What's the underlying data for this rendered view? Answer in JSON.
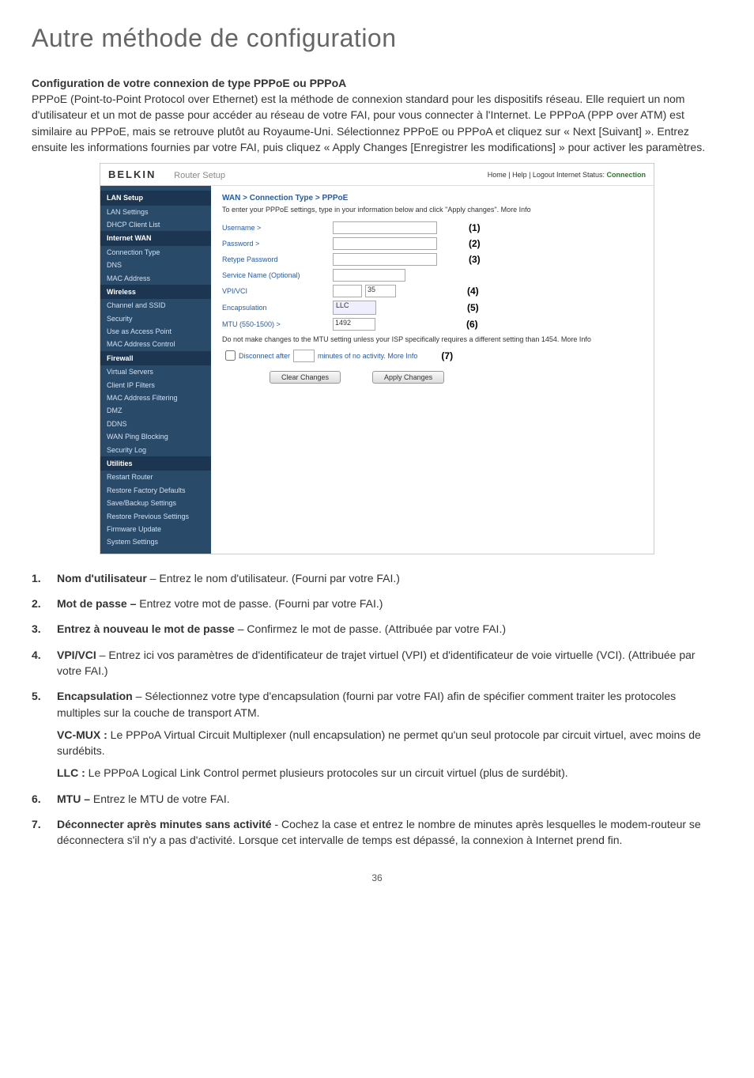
{
  "page": {
    "title": "Autre méthode de configuration",
    "number": "36"
  },
  "heading": "Configuration de votre connexion de type PPPoE ou PPPoA",
  "intro": "PPPoE (Point-to-Point Protocol over Ethernet) est la méthode de connexion standard pour les dispositifs réseau. Elle requiert un nom d'utilisateur et un mot de passe pour accéder au réseau de votre FAI, pour vous connecter à l'Internet. Le PPPoA (PPP over ATM) est similaire au PPPoE, mais se retrouve plutôt au Royaume-Uni. Sélectionnez PPPoE ou PPPoA et cliquez sur « Next [Suivant] ». Entrez ensuite les informations fournies par votre FAI, puis cliquez « Apply Changes [Enregistrer les modifications] » pour activer les paramètres.",
  "screenshot": {
    "brand": "BELKIN",
    "subtitle": "Router Setup",
    "status_prefix": "Home | Help | Logout   Internet Status:",
    "status_value": "Connection",
    "breadcrumb": "WAN > Connection Type > PPPoE",
    "hint": "To enter your PPPoE settings, type in your information below and click \"Apply changes\". More Info",
    "rows": {
      "username": "Username >",
      "password": "Password >",
      "retype": "Retype Password",
      "service": "Service Name (Optional)",
      "vpivci": "VPI/VCI",
      "vpivci_val2": "35",
      "encap": "Encapsulation",
      "encap_val": "LLC",
      "mtu": "MTU (550-1500) >",
      "mtu_val": "1492"
    },
    "markers": {
      "m1": "(1)",
      "m2": "(2)",
      "m3": "(3)",
      "m4": "(4)",
      "m5": "(5)",
      "m6": "(6)",
      "m7": "(7)"
    },
    "mtu_note": "Do not make changes to the MTU setting unless your ISP specifically requires a different setting than 1454. More Info",
    "disconnect_label": "Disconnect after",
    "disconnect_suffix": "minutes of no activity. More Info",
    "clear_btn": "Clear Changes",
    "apply_btn": "Apply Changes",
    "sidebar": {
      "h1": "LAN Setup",
      "i1": "LAN Settings",
      "i2": "DHCP Client List",
      "h2": "Internet WAN",
      "i3": "Connection Type",
      "i4": "DNS",
      "i5": "MAC Address",
      "h3": "Wireless",
      "i6": "Channel and SSID",
      "i7": "Security",
      "i8": "Use as Access Point",
      "i9": "MAC Address Control",
      "h4": "Firewall",
      "i10": "Virtual Servers",
      "i11": "Client IP Filters",
      "i12": "MAC Address Filtering",
      "i13": "DMZ",
      "i14": "DDNS",
      "i15": "WAN Ping Blocking",
      "i16": "Security Log",
      "h5": "Utilities",
      "i17": "Restart Router",
      "i18": "Restore Factory Defaults",
      "i19": "Save/Backup Settings",
      "i20": "Restore Previous Settings",
      "i21": "Firmware Update",
      "i22": "System Settings"
    }
  },
  "list": {
    "n1": "1.",
    "t1": "Nom d'utilisateur",
    "d1": " – Entrez le nom d'utilisateur. (Fourni par votre FAI.)",
    "n2": "2.",
    "t2": "Mot de passe –",
    "d2": " Entrez votre mot de passe. (Fourni par votre FAI.)",
    "n3": "3.",
    "t3": "Entrez à nouveau le mot de passe",
    "d3": " – Confirmez le mot de passe. (Attribuée par votre FAI.)",
    "n4": "4.",
    "t4": "VPI/VCI",
    "d4": " – Entrez ici vos paramètres de d'identificateur de trajet virtuel (VPI) et d'identificateur de voie virtuelle (VCI). (Attribuée par votre FAI.)",
    "n5": "5.",
    "t5": "Encapsulation",
    "d5": " – Sélectionnez votre type d'encapsulation (fourni par votre FAI) afin de spécifier comment traiter les protocoles multiples sur la couche de transport ATM.",
    "vcmux_t": "VC-MUX :",
    "vcmux_d": " Le PPPoA Virtual Circuit Multiplexer (null encapsulation) ne permet qu'un seul protocole par circuit virtuel, avec moins de surdébits.",
    "llc_t": "LLC :",
    "llc_d": " Le PPPoA Logical Link Control permet plusieurs protocoles sur un circuit virtuel (plus de surdébit).",
    "n6": "6.",
    "t6": "MTU –",
    "d6": " Entrez le MTU de votre FAI.",
    "n7": "7.",
    "t7": "Déconnecter après minutes sans activité",
    "d7": " - Cochez la case et entrez le nombre de minutes après lesquelles le modem-routeur se déconnectera s'il n'y a pas d'activité. Lorsque cet intervalle de temps est dépassé, la connexion à Internet prend fin."
  }
}
